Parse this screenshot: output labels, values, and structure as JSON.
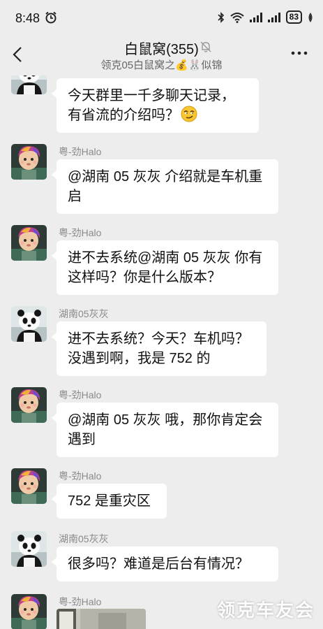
{
  "status_bar": {
    "time": "8:48",
    "battery": "83",
    "icons": [
      "alarm-icon",
      "bluetooth-icon",
      "wifi-icon",
      "signal-icon",
      "signal-icon",
      "battery-icon",
      "leaf-icon"
    ]
  },
  "header": {
    "title": "白鼠窝(355)",
    "subtitle": "领克05白鼠窝之💰🐰似锦",
    "icons": [
      "back-icon",
      "mute-bell-icon",
      "more-icon"
    ]
  },
  "messages": [
    {
      "sender": "",
      "avatar": "panda",
      "text": "今天群里一千多聊天记录，有省流的介绍吗？",
      "emoji": "smirk-emoji"
    },
    {
      "sender": "粤-劲Halo",
      "avatar": "boy",
      "text": "@湖南 05 灰灰  介绍就是车机重启"
    },
    {
      "sender": "粤-劲Halo",
      "avatar": "boy",
      "text": "进不去系统@湖南 05 灰灰  你有这样吗？你是什么版本？"
    },
    {
      "sender": "湖南05灰灰",
      "avatar": "panda",
      "text": "进不去系统？今天？车机吗？没遇到啊，我是 752 的"
    },
    {
      "sender": "粤-劲Halo",
      "avatar": "boy",
      "text": "@湖南 05 灰灰  哦，那你肯定会遇到"
    },
    {
      "sender": "粤-劲Halo",
      "avatar": "boy",
      "text": "752 是重灾区"
    },
    {
      "sender": "湖南05灰灰",
      "avatar": "panda",
      "text": "很多吗？难道是后台有情况？"
    },
    {
      "sender": "粤-劲Halo",
      "avatar": "boy",
      "text": ""
    }
  ],
  "watermark": "领克车友会",
  "colors": {
    "background": "#ededed",
    "bubble": "#ffffff",
    "sender": "#8a8a8a"
  }
}
